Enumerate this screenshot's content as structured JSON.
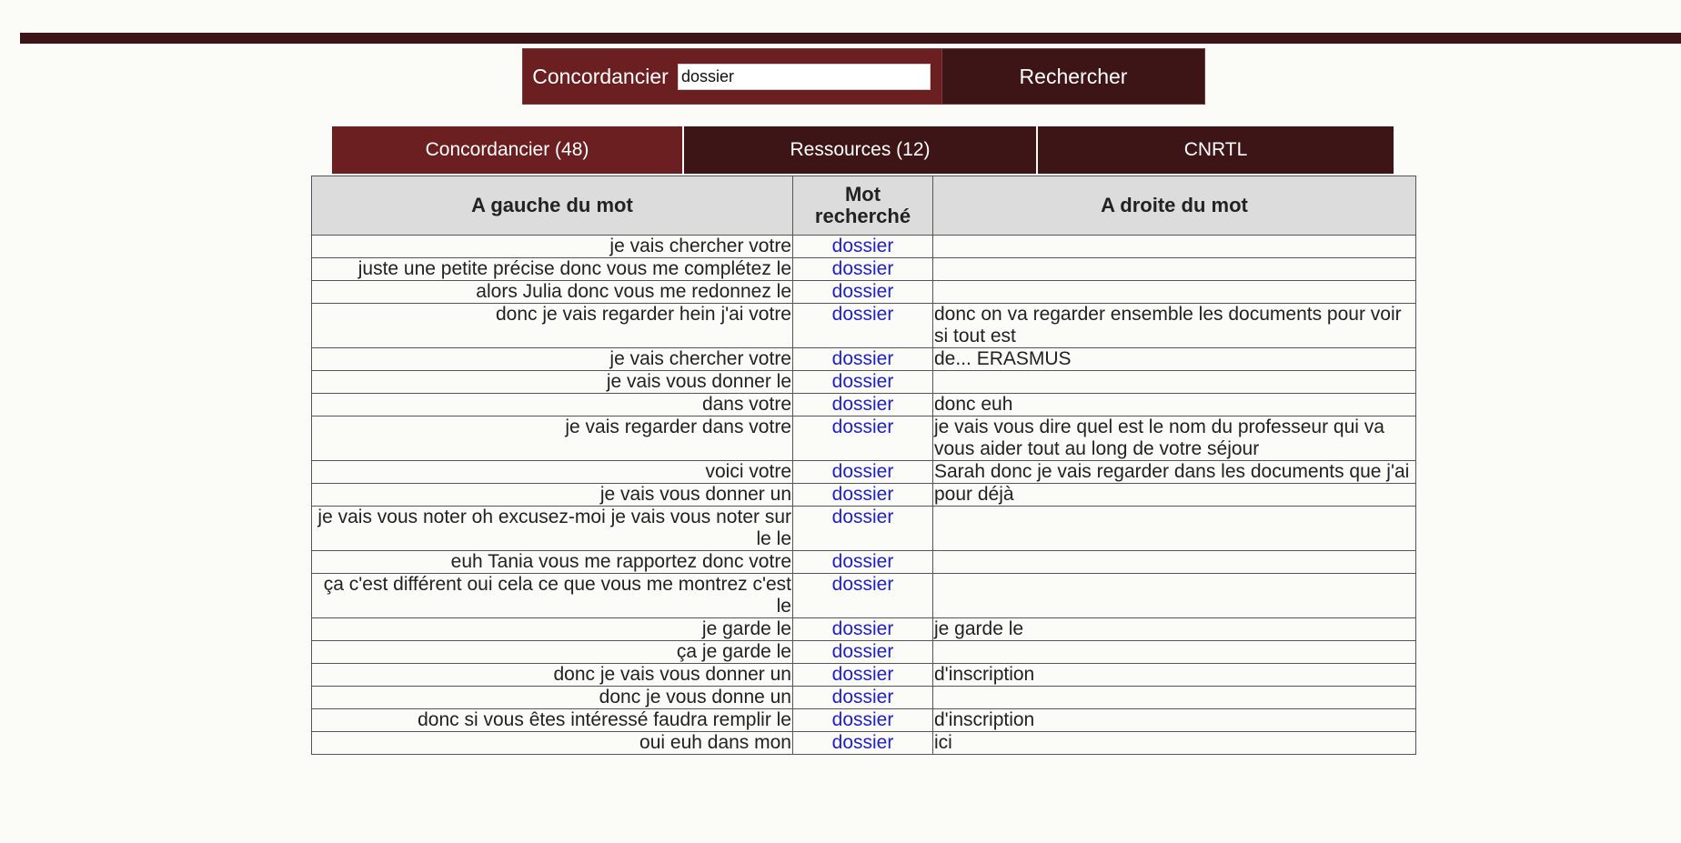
{
  "search": {
    "label": "Concordancier",
    "value": "dossier",
    "button_label": "Rechercher"
  },
  "tabs": [
    {
      "label": "Concordancier (48)",
      "active": true
    },
    {
      "label": "Ressources (12)",
      "active": false
    },
    {
      "label": "CNRTL",
      "active": false
    }
  ],
  "table": {
    "headers": [
      "A gauche du mot",
      "Mot recherché",
      "A droite du mot"
    ],
    "rows": [
      {
        "left": "je vais chercher votre",
        "word": "dossier",
        "right": ""
      },
      {
        "left": "juste une petite précise donc vous me complétez le",
        "word": "dossier",
        "right": ""
      },
      {
        "left": "alors Julia donc vous me redonnez le",
        "word": "dossier",
        "right": ""
      },
      {
        "left": "donc je vais regarder hein j'ai votre",
        "word": "dossier",
        "right": "donc on va regarder ensemble les documents pour voir si tout est"
      },
      {
        "left": "je vais chercher votre",
        "word": "dossier",
        "right": "de... ERASMUS"
      },
      {
        "left": "je vais vous donner le",
        "word": "dossier",
        "right": ""
      },
      {
        "left": "dans votre",
        "word": "dossier",
        "right": "donc euh"
      },
      {
        "left": "je vais regarder dans votre",
        "word": "dossier",
        "right": "je vais vous dire quel est le nom du professeur qui va vous aider tout au long de votre séjour"
      },
      {
        "left": "voici votre",
        "word": "dossier",
        "right": "Sarah donc je vais regarder dans les documents que j'ai"
      },
      {
        "left": "je vais vous donner un",
        "word": "dossier",
        "right": "pour déjà"
      },
      {
        "left": "je vais vous noter oh excusez-moi je vais vous noter sur le le",
        "word": "dossier",
        "right": ""
      },
      {
        "left": "euh Tania vous me rapportez donc votre",
        "word": "dossier",
        "right": ""
      },
      {
        "left": "ça c'est différent oui cela ce que vous me montrez c'est le",
        "word": "dossier",
        "right": ""
      },
      {
        "left": "je garde le",
        "word": "dossier",
        "right": "je garde le"
      },
      {
        "left": "ça je garde le",
        "word": "dossier",
        "right": ""
      },
      {
        "left": "donc je vais vous donner un",
        "word": "dossier",
        "right": "d'inscription"
      },
      {
        "left": "donc je vous donne un",
        "word": "dossier",
        "right": ""
      },
      {
        "left": "donc si vous êtes intéressé faudra remplir le",
        "word": "dossier",
        "right": "d'inscription"
      },
      {
        "left": "oui euh dans mon",
        "word": "dossier",
        "right": "ici"
      }
    ]
  },
  "colors": {
    "dark_bar": "#3b1517",
    "active_tab": "#6b1f20",
    "inactive_tab": "#3d1517",
    "link": "#2020c8",
    "header_bg": "#dcdcdc"
  }
}
